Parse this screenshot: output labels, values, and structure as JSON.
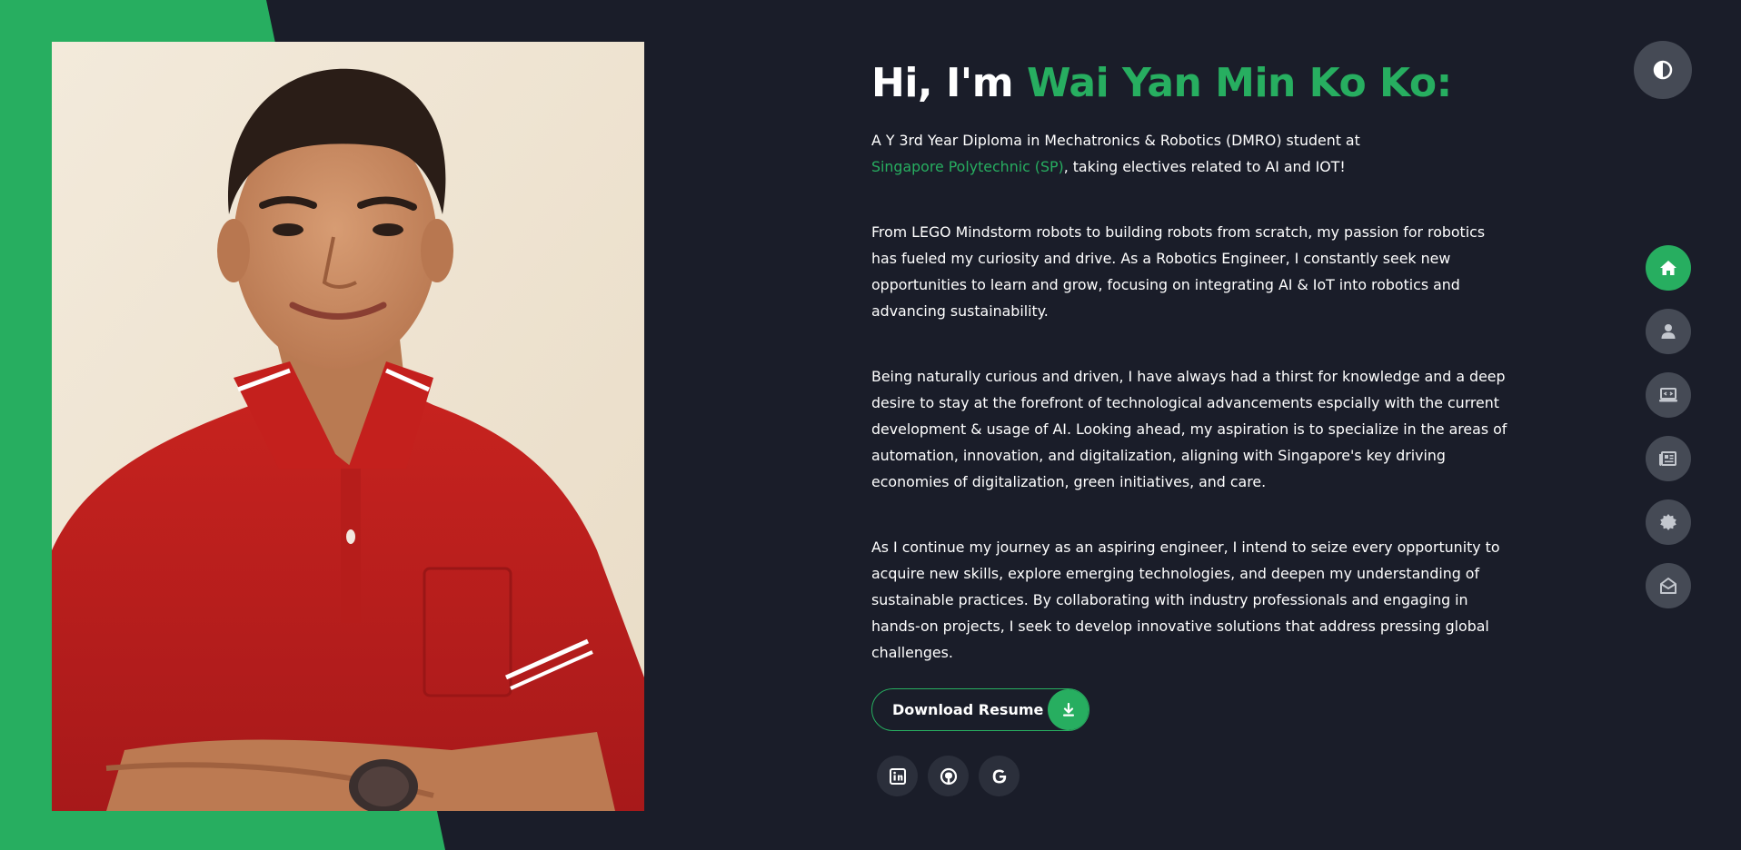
{
  "hero": {
    "greeting": "Hi, I'm ",
    "name": "Wai Yan Min Ko Ko:",
    "intro_prefix": "A Y 3rd Year Diploma in Mechatronics & Robotics (DMRO) student at",
    "school_link": "Singapore Polytechnic (SP)",
    "intro_suffix": ", taking electives related to AI and IOT!",
    "paragraph_2": "From LEGO Mindstorm robots to building robots from scratch, my passion for robotics has fueled my curiosity and drive. As a Robotics Engineer, I constantly seek new opportunities to learn and grow, focusing on integrating AI & IoT into robotics and advancing sustainability.",
    "paragraph_3": "Being naturally curious and driven, I have always had a thirst for knowledge and a deep desire to stay at the forefront of technological advancements espcially with the current development & usage of AI. Looking ahead, my aspiration is to specialize in the areas of automation, innovation, and digitalization, aligning with Singapore's key driving economies of digitalization, green initiatives, and care.",
    "paragraph_4": "As I continue my journey as an aspiring engineer, I intend to seize every opportunity to acquire new skills, explore emerging technologies, and deepen my understanding of sustainable practices. By collaborating with industry professionals and engaging in hands-on projects, I seek to develop innovative solutions that address pressing global challenges."
  },
  "resume_button": {
    "label": "Download Resume",
    "icon": "download-icon"
  },
  "socials": [
    {
      "icon": "linkedin-icon"
    },
    {
      "icon": "github-icon"
    },
    {
      "icon": "google-icon"
    }
  ],
  "theme_toggle": {
    "icon": "contrast-icon"
  },
  "nav": [
    {
      "icon": "home-icon",
      "active": true
    },
    {
      "icon": "user-icon",
      "active": false
    },
    {
      "icon": "laptop-code-icon",
      "active": false
    },
    {
      "icon": "newspaper-icon",
      "active": false
    },
    {
      "icon": "certificate-icon",
      "active": false
    },
    {
      "icon": "envelope-open-icon",
      "active": false
    }
  ],
  "colors": {
    "background": "#1a1d29",
    "accent": "#27ae60",
    "nav_button": "#454a55",
    "social_button": "#2b2f3b"
  }
}
